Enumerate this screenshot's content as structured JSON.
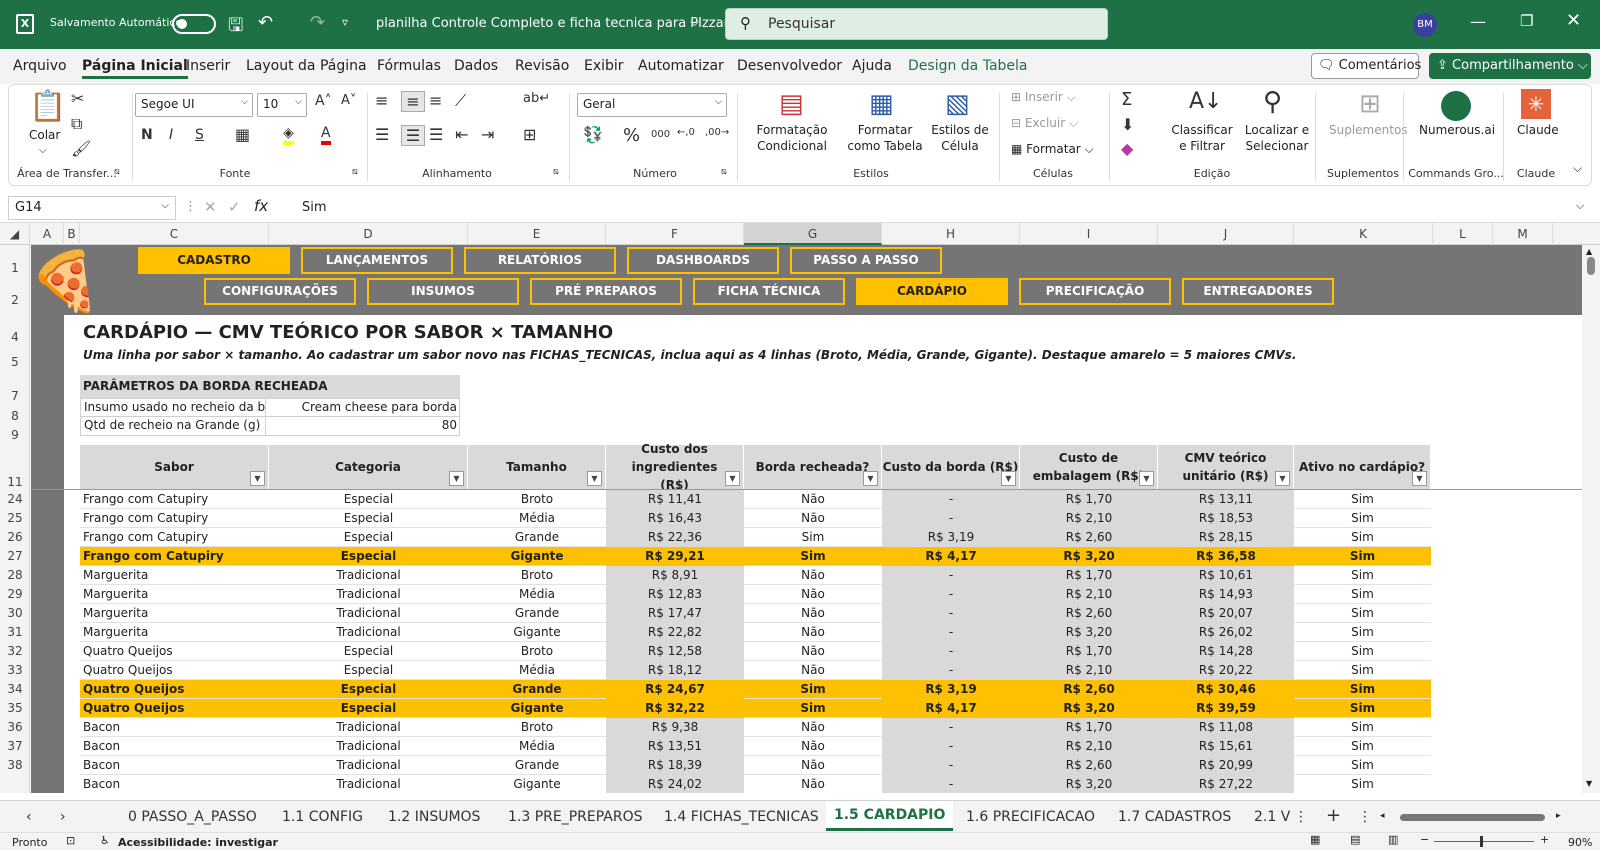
{
  "title_bar": {
    "autosave_label": "Salvamento Automático",
    "file_name": "planilha Controle Completo e ficha tecnica para PIzzaria",
    "search_placeholder": "Pesquisar",
    "user_initials": "BM"
  },
  "menu": {
    "items": [
      "Arquivo",
      "Página Inicial",
      "Inserir",
      "Layout da Página",
      "Fórmulas",
      "Dados",
      "Revisão",
      "Exibir",
      "Automatizar",
      "Desenvolvedor",
      "Ajuda",
      "Design da Tabela"
    ],
    "comments": "Comentários",
    "share": "Compartilhamento"
  },
  "ribbon": {
    "paste": "Colar",
    "clipboard": "Área de Transfer...",
    "font_name": "Segoe UI",
    "font_size": "10",
    "font_group": "Fonte",
    "alignment_group": "Alinhamento",
    "number_format": "Geral",
    "number_group": "Número",
    "cond_format": "Formatação Condicional",
    "format_table": "Formatar como Tabela",
    "cell_styles": "Estilos de Célula",
    "styles_group": "Estilos",
    "insert": "Inserir",
    "delete": "Excluir",
    "format": "Formatar",
    "cells_group": "Células",
    "sort": "Classificar e Filtrar",
    "find": "Localizar e Selecionar",
    "edit_group": "Edição",
    "addins": "Suplementos",
    "addins_group": "Suplementos",
    "numerous": "Numerous.ai",
    "commands_group": "Commands Gro...",
    "claude": "Claude",
    "claude_group": "Claude"
  },
  "formula_bar": {
    "cell_ref": "G14",
    "value": "Sim"
  },
  "columns": [
    "A",
    "B",
    "C",
    "D",
    "E",
    "F",
    "G",
    "H",
    "I",
    "J",
    "K",
    "L",
    "M"
  ],
  "row_numbers": [
    "1",
    "2",
    "4",
    "5",
    "7",
    "8",
    "9",
    "11",
    "24",
    "25",
    "26",
    "27",
    "28",
    "29",
    "30",
    "31",
    "32",
    "33",
    "34",
    "35",
    "36",
    "37",
    "38"
  ],
  "nav_top": [
    "CADASTRO",
    "LANÇAMENTOS",
    "RELATÓRIOS",
    "DASHBOARDS",
    "PASSO A PASSO"
  ],
  "nav_bottom": [
    "CONFIGURAÇÕES",
    "INSUMOS",
    "PRÉ PREPAROS",
    "FICHA TÉCNICA",
    "CARDÁPIO",
    "PRECIFICAÇÃO",
    "ENTREGADORES"
  ],
  "sheet": {
    "title": "CARDÁPIO — CMV TEÓRICO POR SABOR × TAMANHO",
    "subtitle": "Uma linha por sabor × tamanho. Ao cadastrar um sabor novo nas FICHAS_TECNICAS, inclua aqui as 4 linhas (Broto, Média, Grande, Gigante). Destaque amarelo = 5 maiores CMVs.",
    "params_title": "PARÂMETROS DA BORDA RECHEADA",
    "param1_label": "Insumo usado no recheio da bord",
    "param1_value": "Cream cheese para borda",
    "param2_label": "Qtd de recheio na Grande (g)",
    "param2_value": "80"
  },
  "table": {
    "headers": [
      "Sabor",
      "Categoria",
      "Tamanho",
      "Custo dos ingredientes (R$)",
      "Borda recheada?",
      "Custo da borda (R$)",
      "Custo de embalagem (R$)",
      "CMV teórico unitário (R$)",
      "Ativo no cardápio?"
    ],
    "rows": [
      [
        "Frango com Catupiry",
        "Especial",
        "Broto",
        "R$ 11,41",
        "Não",
        "-",
        "R$ 1,70",
        "R$ 13,11",
        "Sim"
      ],
      [
        "Frango com Catupiry",
        "Especial",
        "Média",
        "R$ 16,43",
        "Não",
        "-",
        "R$ 2,10",
        "R$ 18,53",
        "Sim"
      ],
      [
        "Frango com Catupiry",
        "Especial",
        "Grande",
        "R$ 22,36",
        "Sim",
        "R$ 3,19",
        "R$ 2,60",
        "R$ 28,15",
        "Sim"
      ],
      [
        "Frango com Catupiry",
        "Especial",
        "Gigante",
        "R$ 29,21",
        "Sim",
        "R$ 4,17",
        "R$ 3,20",
        "R$ 36,58",
        "Sim"
      ],
      [
        "Marguerita",
        "Tradicional",
        "Broto",
        "R$ 8,91",
        "Não",
        "-",
        "R$ 1,70",
        "R$ 10,61",
        "Sim"
      ],
      [
        "Marguerita",
        "Tradicional",
        "Média",
        "R$ 12,83",
        "Não",
        "-",
        "R$ 2,10",
        "R$ 14,93",
        "Sim"
      ],
      [
        "Marguerita",
        "Tradicional",
        "Grande",
        "R$ 17,47",
        "Não",
        "-",
        "R$ 2,60",
        "R$ 20,07",
        "Sim"
      ],
      [
        "Marguerita",
        "Tradicional",
        "Gigante",
        "R$ 22,82",
        "Não",
        "-",
        "R$ 3,20",
        "R$ 26,02",
        "Sim"
      ],
      [
        "Quatro Queijos",
        "Especial",
        "Broto",
        "R$ 12,58",
        "Não",
        "-",
        "R$ 1,70",
        "R$ 14,28",
        "Sim"
      ],
      [
        "Quatro Queijos",
        "Especial",
        "Média",
        "R$ 18,12",
        "Não",
        "-",
        "R$ 2,10",
        "R$ 20,22",
        "Sim"
      ],
      [
        "Quatro Queijos",
        "Especial",
        "Grande",
        "R$ 24,67",
        "Sim",
        "R$ 3,19",
        "R$ 2,60",
        "R$ 30,46",
        "Sim"
      ],
      [
        "Quatro Queijos",
        "Especial",
        "Gigante",
        "R$ 32,22",
        "Sim",
        "R$ 4,17",
        "R$ 3,20",
        "R$ 39,59",
        "Sim"
      ],
      [
        "Bacon",
        "Tradicional",
        "Broto",
        "R$ 9,38",
        "Não",
        "-",
        "R$ 1,70",
        "R$ 11,08",
        "Sim"
      ],
      [
        "Bacon",
        "Tradicional",
        "Média",
        "R$ 13,51",
        "Não",
        "-",
        "R$ 2,10",
        "R$ 15,61",
        "Sim"
      ],
      [
        "Bacon",
        "Tradicional",
        "Grande",
        "R$ 18,39",
        "Não",
        "-",
        "R$ 2,60",
        "R$ 20,99",
        "Sim"
      ],
      [
        "Bacon",
        "Tradicional",
        "Gigante",
        "R$ 24,02",
        "Não",
        "-",
        "R$ 3,20",
        "R$ 27,22",
        "Sim"
      ]
    ],
    "highlighted_rows": [
      3,
      10,
      11
    ]
  },
  "sheet_tabs": [
    "0 PASSO_A_PASSO",
    "1.1 CONFIG",
    "1.2 INSUMOS",
    "1.3 PRE_PREPAROS",
    "1.4 FICHAS_TECNICAS",
    "1.5 CARDAPIO",
    "1.6 PRECIFICACAO",
    "1.7 CADASTROS",
    "2.1 V"
  ],
  "active_tab": "1.5 CARDAPIO",
  "status": {
    "ready": "Pronto",
    "accessibility": "Acessibilidade: investigar",
    "zoom": "90%"
  },
  "colors": {
    "excel_green": "#1e7145",
    "nav_gray": "#757575",
    "accent_yellow": "#ffc000"
  }
}
